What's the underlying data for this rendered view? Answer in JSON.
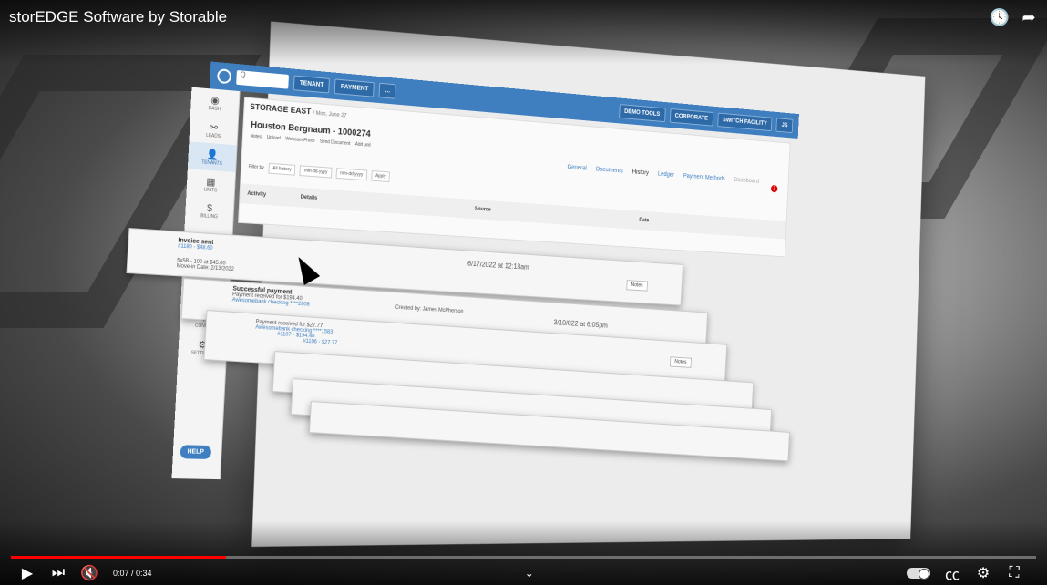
{
  "video": {
    "title": "storEDGE Software by Storable",
    "time": "0:07 / 0:34",
    "progress_fraction": 0.21
  },
  "icons": {
    "watch_later": "clock-icon",
    "share": "share-icon",
    "play": "play-icon",
    "next": "next-icon",
    "mute": "mute-icon",
    "chevron": "chevron-down-icon",
    "autoplay": "autoplay-toggle",
    "captions": "captions-icon",
    "settings": "gear-icon",
    "fullscreen": "exit-fullscreen-icon"
  },
  "app": {
    "search_placeholder": "Q",
    "top_buttons": {
      "tenant": "TENANT",
      "payment": "PAYMENT",
      "more": "..."
    },
    "right_buttons": {
      "demo": "DEMO TOOLS",
      "corporate": "CORPORATE",
      "switch": "SWITCH FACILITY",
      "user": "JS"
    },
    "sidebar": [
      {
        "label": "DASH",
        "icon": "◉"
      },
      {
        "label": "LEADS",
        "icon": "⚯"
      },
      {
        "label": "TENANTS",
        "icon": "👤"
      },
      {
        "label": "UNITS",
        "icon": "▦"
      },
      {
        "label": "BILLING",
        "icon": "$"
      },
      {
        "label": "",
        "icon": "⏰"
      }
    ],
    "sidebar_lower": [
      {
        "label": "CONFIG",
        "icon": "⚙"
      },
      {
        "label": "SETTINGS",
        "icon": "⚙"
      }
    ],
    "help": "HELP",
    "facility": "STORAGE EAST",
    "facility_date": "/ Mon, June 27",
    "tenant_name": "Houston Bergnaum - 1000274",
    "actions": [
      "Notes",
      "Upload",
      "Webcam Photo",
      "Send Document",
      "Add unit"
    ],
    "tabs": [
      "General",
      "Documents",
      "History",
      "Ledger",
      "Payment Methods",
      "Dashboard"
    ],
    "filter_label": "Filter by",
    "filter_value": "All history",
    "date_placeholder": "mm-dd-yyyy",
    "apply": "Apply",
    "headers": {
      "activity": "Activity",
      "details": "Details",
      "source": "Source",
      "date": "Date"
    },
    "notification_count": "1"
  },
  "rows": {
    "invoice_title": "Invoice sent",
    "invoice_link": "#1180 - $48.60",
    "unit_line": "5x5B - 100 at $45.00",
    "movein": "Move-in Date: 2/13/2022",
    "row1_date": "6/17/2022 at 12:13am",
    "notes": "Notes",
    "payment_title": "Successful payment",
    "payment_amount": "Payment received for $194.40",
    "payment_method": "Awesomebank checking ****2808",
    "created_by": "Created by: James McPherson",
    "row2_date": "3/10/022 at 6:05pm",
    "payment2": "Payment received for $27.77",
    "payment2_method": "Awesomebank checking ****1583",
    "link_a": "#1107 - $194.40",
    "link_b": "#1106 - $27.77"
  }
}
